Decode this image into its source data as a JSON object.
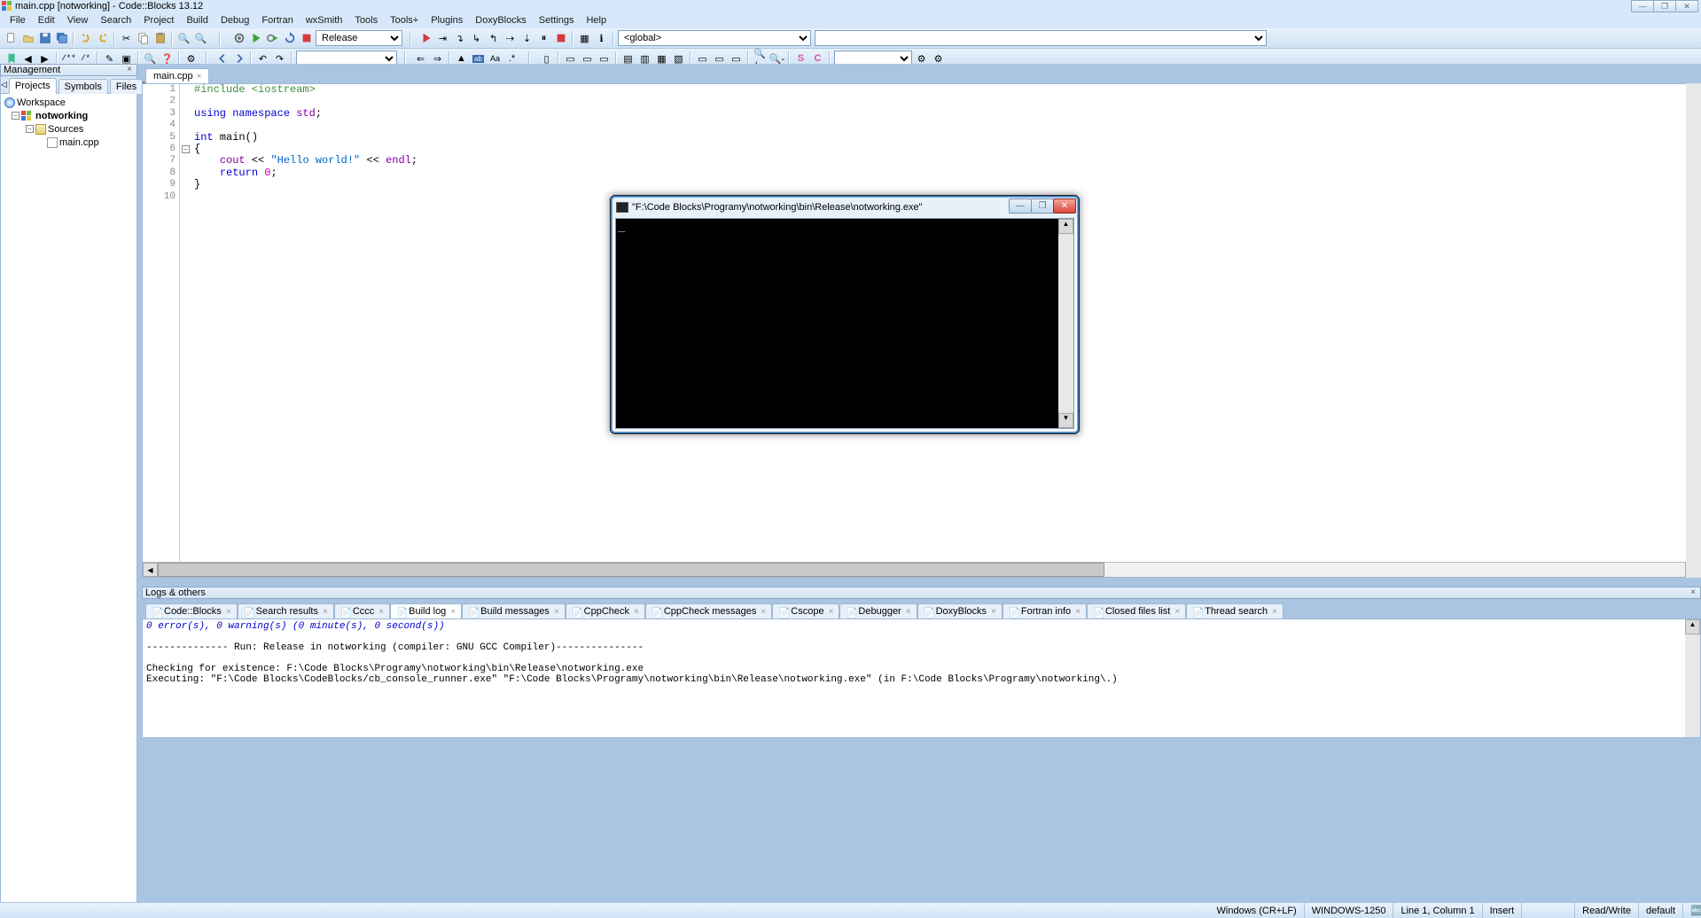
{
  "title": "main.cpp [notworking] - Code::Blocks 13.12",
  "menu": [
    "File",
    "Edit",
    "View",
    "Search",
    "Project",
    "Build",
    "Debug",
    "Fortran",
    "wxSmith",
    "Tools",
    "Tools+",
    "Plugins",
    "DoxyBlocks",
    "Settings",
    "Help"
  ],
  "build_config": "Release",
  "scope_combo": "<global>",
  "management": {
    "title": "Management",
    "tabs": [
      "Projects",
      "Symbols",
      "Files"
    ],
    "active_tab": "Projects",
    "tree": {
      "workspace": "Workspace",
      "project": "notworking",
      "sources": "Sources",
      "file": "main.cpp"
    }
  },
  "editor": {
    "tab": "main.cpp",
    "lines": [
      {
        "n": 1,
        "html": "<span class='kw-prep'>#include &lt;iostream&gt;</span>"
      },
      {
        "n": 2,
        "html": ""
      },
      {
        "n": 3,
        "html": "<span class='kw-blue'>using</span> <span class='kw-blue'>namespace</span> <span class='kw-purple'>std</span>;"
      },
      {
        "n": 4,
        "html": ""
      },
      {
        "n": 5,
        "html": "<span class='kw-blue'>int</span> main<span class='kw-black'>()</span>"
      },
      {
        "n": 6,
        "html": "{"
      },
      {
        "n": 7,
        "html": "    <span class='kw-purple'>cout</span> &lt;&lt; <span class='kw-str'>\"Hello world!\"</span> &lt;&lt; <span class='kw-purple'>endl</span>;"
      },
      {
        "n": 8,
        "html": "    <span class='kw-blue'>return</span> <span class='kw-num'>0</span>;"
      },
      {
        "n": 9,
        "html": "}"
      },
      {
        "n": 10,
        "html": ""
      }
    ]
  },
  "logs": {
    "title": "Logs & others",
    "tabs": [
      "Code::Blocks",
      "Search results",
      "Cccc",
      "Build log",
      "Build messages",
      "CppCheck",
      "CppCheck messages",
      "Cscope",
      "Debugger",
      "DoxyBlocks",
      "Fortran info",
      "Closed files list",
      "Thread search"
    ],
    "active": "Build log",
    "text_top": "0 error(s), 0 warning(s) (0 minute(s), 0 second(s))",
    "lines": [
      "",
      "-------------- Run: Release in notworking (compiler: GNU GCC Compiler)---------------",
      "",
      "Checking for existence: F:\\Code Blocks\\Programy\\notworking\\bin\\Release\\notworking.exe",
      "Executing: \"F:\\Code Blocks\\CodeBlocks/cb_console_runner.exe\" \"F:\\Code Blocks\\Programy\\notworking\\bin\\Release\\notworking.exe\"  (in F:\\Code Blocks\\Programy\\notworking\\.)"
    ]
  },
  "status": {
    "eol": "Windows (CR+LF)",
    "encoding": "WINDOWS-1250",
    "pos": "Line 1, Column 1",
    "insert": "Insert",
    "rw": "Read/Write",
    "profile": "default"
  },
  "console": {
    "title": "\"F:\\Code Blocks\\Programy\\notworking\\bin\\Release\\notworking.exe\"",
    "cursor": "_"
  }
}
